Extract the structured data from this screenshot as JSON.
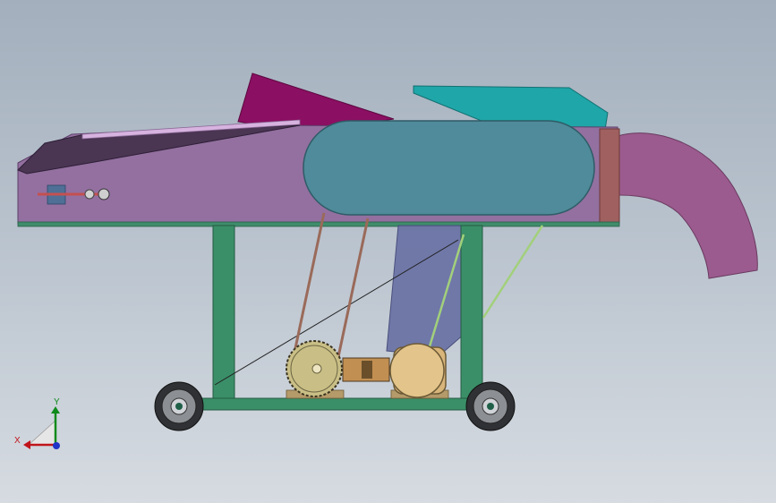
{
  "viewport": {
    "background_top": "#a3afbd",
    "background_bottom": "#d6dbe1"
  },
  "model": {
    "parts": [
      {
        "name": "feed-tray",
        "color": "#9370a0"
      },
      {
        "name": "feed-tray-lip",
        "color": "#4a3553"
      },
      {
        "name": "hopper",
        "color": "#8b0f62"
      },
      {
        "name": "top-cover",
        "color": "#1fa6a8"
      },
      {
        "name": "cutter-drum-housing",
        "color": "#4f8b9a"
      },
      {
        "name": "discharge-chute",
        "color": "#9b5b8e"
      },
      {
        "name": "frame",
        "color": "#3a8f68"
      },
      {
        "name": "belt-guard",
        "color": "#6c74a6"
      },
      {
        "name": "pulley",
        "color": "#c9bf86"
      },
      {
        "name": "motor",
        "color": "#d8b57a"
      },
      {
        "name": "wheels",
        "color": "#55585d"
      },
      {
        "name": "belts",
        "color": "#9a6a5a"
      }
    ]
  },
  "triad": {
    "x_label": "X",
    "y_label": "Y",
    "x_color": "#c0151b",
    "y_color": "#0f8a1b",
    "z_color": "#1f35c8"
  }
}
